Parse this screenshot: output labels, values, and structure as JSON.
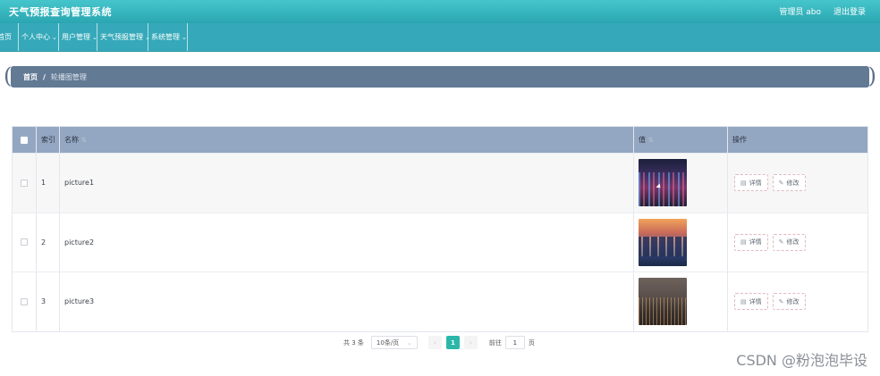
{
  "header": {
    "title": "天气预报查询管理系统",
    "user_label": "管理员 abo",
    "logout_label": "退出登录"
  },
  "nav": {
    "items": [
      {
        "label": "首页",
        "has_dropdown": false
      },
      {
        "label": "个人中心",
        "has_dropdown": true
      },
      {
        "label": "用户管理",
        "has_dropdown": true
      },
      {
        "label": "天气预报管理",
        "has_dropdown": true
      },
      {
        "label": "系统管理",
        "has_dropdown": true
      }
    ]
  },
  "breadcrumb": {
    "home": "首页",
    "separator": "/",
    "current": "轮播图管理"
  },
  "table": {
    "columns": [
      "索引",
      "名称",
      "值",
      "操作"
    ],
    "rows": [
      {
        "index": "1",
        "name": "picture1",
        "thumb": "city-night-image"
      },
      {
        "index": "2",
        "name": "picture2",
        "thumb": "city-sunset-image"
      },
      {
        "index": "3",
        "name": "picture3",
        "thumb": "city-aerial-image"
      }
    ],
    "detail_label": "详情",
    "edit_label": "修改"
  },
  "pagination": {
    "total": "共 3 条",
    "page_size": "10条/页",
    "prev": "‹",
    "current_page": "1",
    "next": "›",
    "goto_label": "前往",
    "goto_value": "1",
    "page_unit": "页"
  },
  "watermark": "CSDN @粉泡泡毕设",
  "colors": {
    "header_top": "#46c6cc",
    "nav_bg": "#35a9b9",
    "breadcrumb_bg": "#627a94",
    "table_head_bg": "#94a7c2",
    "accent": "#2ab7a9"
  }
}
